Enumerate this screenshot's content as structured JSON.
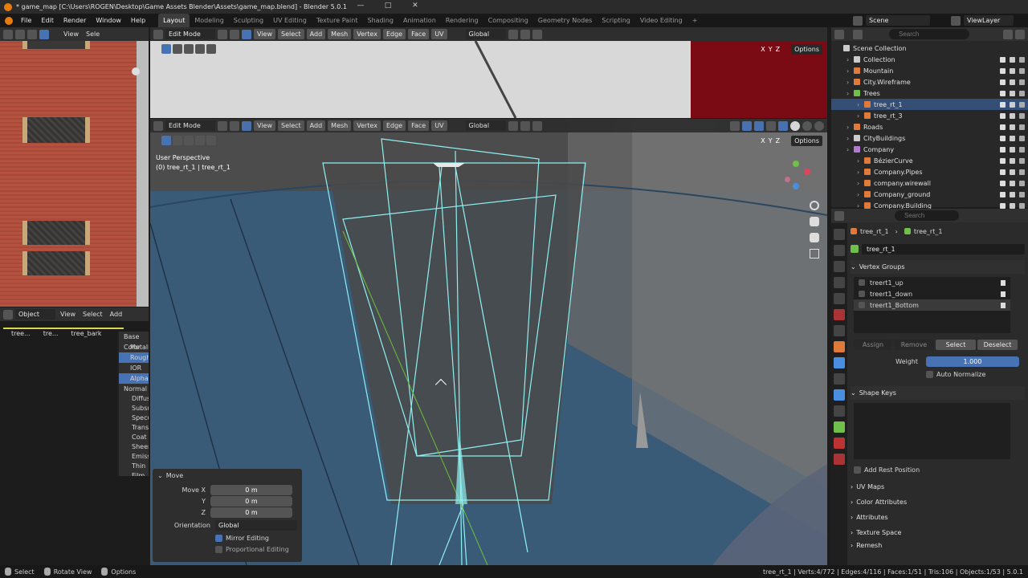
{
  "title_bar": {
    "title": "* game_map [C:\\Users\\ROGEN\\Desktop\\Game Assets Blender\\Assets\\game_map.blend] - Blender 5.0.1",
    "minimize": "—",
    "maximize": "□",
    "close": "✕"
  },
  "menu": {
    "items": [
      "File",
      "Edit",
      "Render",
      "Window",
      "Help"
    ]
  },
  "workspaces": {
    "tabs": [
      "Layout",
      "Modeling",
      "Sculpting",
      "UV Editing",
      "Texture Paint",
      "Shading",
      "Animation",
      "Rendering",
      "Compositing",
      "Geometry Nodes",
      "Scripting",
      "Video Editing"
    ],
    "add": "+"
  },
  "scene": {
    "label": "Scene",
    "view_layer": "ViewLayer"
  },
  "image_editor": {
    "view": "View",
    "sel": "Sele"
  },
  "viewport_top": {
    "mode": "Edit Mode",
    "menus": [
      "View",
      "Select",
      "Add",
      "Mesh",
      "Vertex",
      "Edge",
      "Face",
      "UV"
    ],
    "orientation": "Global",
    "options": "Options",
    "axes": [
      "X",
      "Y",
      "Z"
    ]
  },
  "viewport_main": {
    "mode": "Edit Mode",
    "menus": [
      "View",
      "Select",
      "Add",
      "Mesh",
      "Vertex",
      "Edge",
      "Face",
      "UV"
    ],
    "orientation": "Global",
    "options": "Options",
    "axes": [
      "X",
      "Y",
      "Z"
    ],
    "perspective": "User Perspective",
    "object_info": "(0) tree_rt_1 | tree_rt_1"
  },
  "node_editor": {
    "mode": "Object",
    "menus": [
      "View",
      "Select",
      "Add"
    ],
    "breadcrumb": [
      "tree...",
      "tre...",
      "tree_bark"
    ],
    "sockets": [
      "Base Color",
      "Metallic",
      "Roughness",
      "IOR",
      "Alpha",
      "Normal",
      "Diffuse",
      "Subsurface",
      "Specular",
      "Transmission",
      "Coat",
      "Sheen",
      "Emission",
      "Thin Film"
    ]
  },
  "move_panel": {
    "title": "Move",
    "x_label": "Move X",
    "x": "0 m",
    "y_label": "Y",
    "y": "0 m",
    "z_label": "Z",
    "z": "0 m",
    "orientation_label": "Orientation",
    "orientation": "Global",
    "mirror": "Mirror Editing",
    "proportional": "Proportional Editing"
  },
  "outliner": {
    "search_placeholder": "Search",
    "items": [
      {
        "name": "Scene Collection",
        "indent": 0,
        "color": "#cccccc"
      },
      {
        "name": "Collection",
        "indent": 1,
        "color": "#cccccc"
      },
      {
        "name": "Mountain",
        "indent": 1,
        "color": "#e07a3a"
      },
      {
        "name": "City.Wireframe",
        "indent": 1,
        "color": "#e07a3a"
      },
      {
        "name": "Trees",
        "indent": 1,
        "color": "#6fbf4a"
      },
      {
        "name": "tree_rt_1",
        "indent": 2,
        "color": "#e07a3a"
      },
      {
        "name": "tree_rt_3",
        "indent": 2,
        "color": "#e07a3a"
      },
      {
        "name": "Roads",
        "indent": 1,
        "color": "#e07a3a"
      },
      {
        "name": "CityBuildings",
        "indent": 1,
        "color": "#cccccc"
      },
      {
        "name": "Company",
        "indent": 1,
        "color": "#b07ad0"
      },
      {
        "name": "BézierCurve",
        "indent": 2,
        "color": "#e07a3a"
      },
      {
        "name": "Company.Pipes",
        "indent": 2,
        "color": "#e07a3a"
      },
      {
        "name": "company.wirewall",
        "indent": 2,
        "color": "#e07a3a"
      },
      {
        "name": "Company_ground",
        "indent": 2,
        "color": "#e07a3a"
      },
      {
        "name": "Company.Building",
        "indent": 2,
        "color": "#e07a3a"
      }
    ]
  },
  "properties": {
    "search_placeholder": "Search",
    "breadcrumb_obj": "tree_rt_1",
    "breadcrumb_mesh": "tree_rt_1",
    "mesh_name": "tree_rt_1",
    "vertex_groups_title": "Vertex Groups",
    "vertex_groups": [
      "treert1_up",
      "treert1_down",
      "treert1_Bottom"
    ],
    "assign": "Assign",
    "remove": "Remove",
    "select": "Select",
    "deselect": "Deselect",
    "weight_label": "Weight",
    "weight": "1.000",
    "auto_normalize": "Auto Normalize",
    "shape_keys_title": "Shape Keys",
    "add_rest": "Add Rest Position",
    "sections": [
      "UV Maps",
      "Color Attributes",
      "Attributes",
      "Texture Space",
      "Remesh"
    ]
  },
  "status": {
    "select": "Select",
    "rotate": "Rotate View",
    "options": "Options",
    "stats": "tree_rt_1 | Verts:4/772 | Edges:4/116 | Faces:1/51 | Tris:106 | Objects:1/53 | 5.0.1"
  }
}
